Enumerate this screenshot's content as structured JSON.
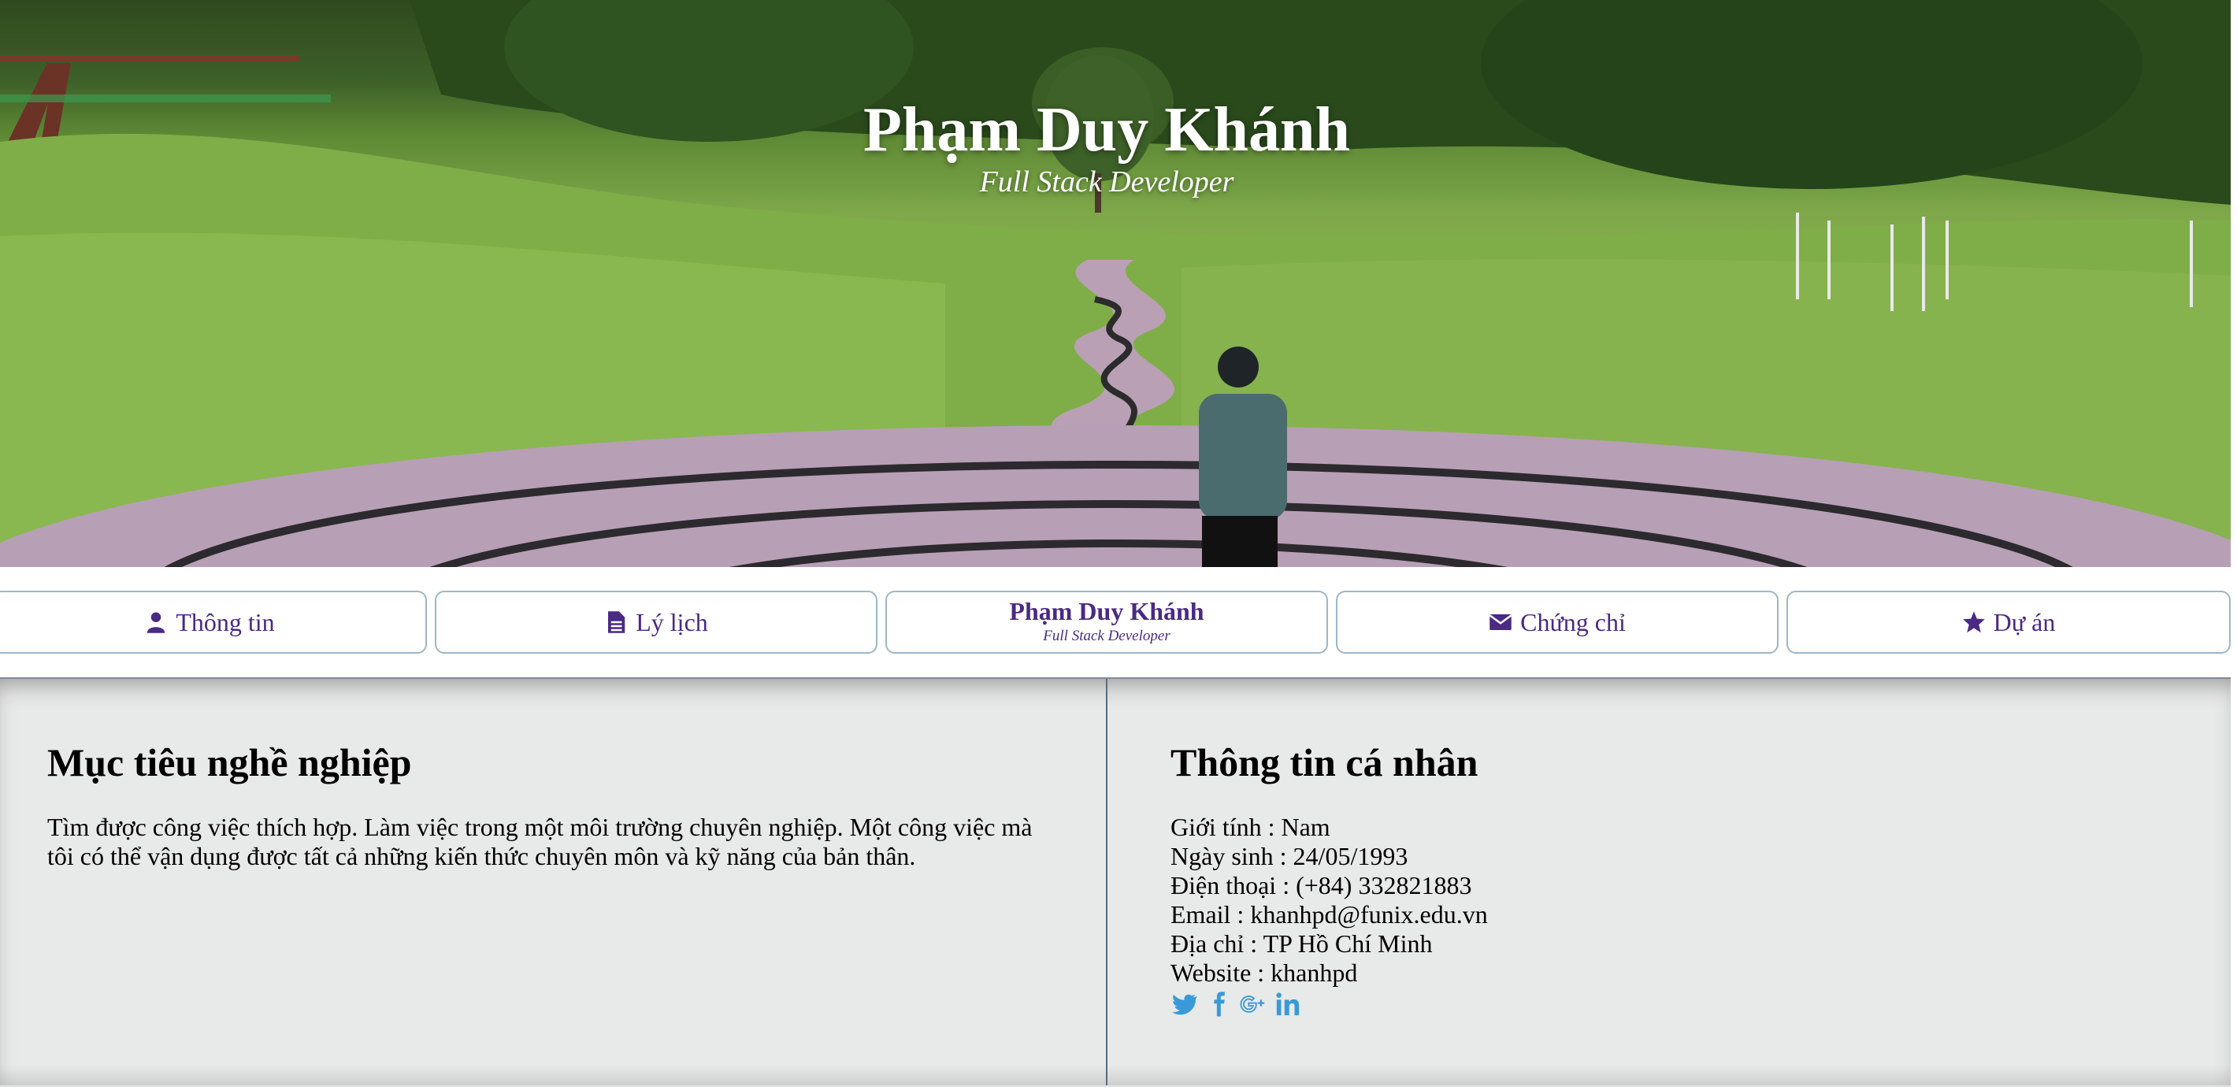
{
  "hero": {
    "title": "Phạm Duy Khánh",
    "subtitle": "Full Stack Developer"
  },
  "nav": {
    "items": [
      {
        "label": "Thông tin",
        "icon": "user-icon"
      },
      {
        "label": "Lý lịch",
        "icon": "file-icon"
      },
      {
        "name": "Phạm Duy Khánh",
        "role": "Full Stack Developer"
      },
      {
        "label": "Chứng chỉ",
        "icon": "envelope-icon"
      },
      {
        "label": "Dự án",
        "icon": "star-icon"
      }
    ]
  },
  "career": {
    "title": "Mục tiêu nghề nghiệp",
    "line1": "Tìm được công việc thích hợp. Làm việc trong một môi trường chuyên nghiệp. Một công việc mà",
    "line2": "tôi có thể vận dụng được tất cả những kiến thức chuyên môn và kỹ năng của bản thân."
  },
  "personal": {
    "title": "Thông tin cá nhân",
    "rows": [
      "Giới tính : Nam",
      "Ngày sinh : 24/05/1993",
      "Điện thoại : (+84) 332821883",
      "Email : khanhpd@funix.edu.vn",
      "Địa chỉ : TP Hồ Chí Minh",
      "Website : khanhpd"
    ],
    "social": [
      "twitter-icon",
      "facebook-icon",
      "google-plus-icon",
      "linkedin-icon"
    ]
  },
  "colors": {
    "accent": "#4a2a84",
    "social": "#3a9ad9",
    "content_bg": "#e8e9e9"
  }
}
